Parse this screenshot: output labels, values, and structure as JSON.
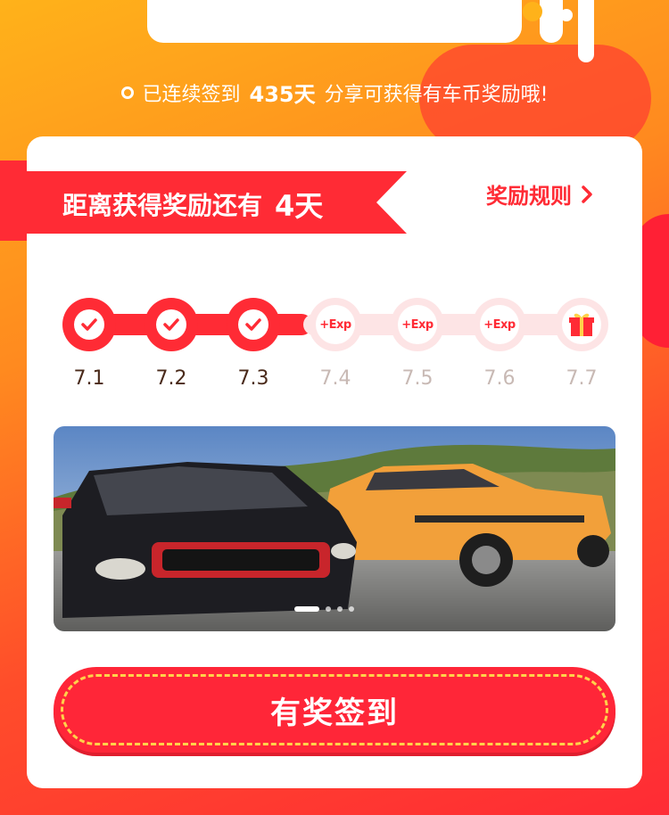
{
  "streak": {
    "prefix": "已连续签到",
    "days": "435天",
    "suffix": "分享可获得有车币奖励哦!"
  },
  "reward": {
    "label": "距离获得奖励还有",
    "days": "4天",
    "rules_label": "奖励规则"
  },
  "checkin": [
    {
      "date": "7.1",
      "status": "done",
      "badge": ""
    },
    {
      "date": "7.2",
      "status": "done",
      "badge": ""
    },
    {
      "date": "7.3",
      "status": "done",
      "badge": ""
    },
    {
      "date": "7.4",
      "status": "todo",
      "badge": "+Exp"
    },
    {
      "date": "7.5",
      "status": "todo",
      "badge": "+Exp"
    },
    {
      "date": "7.6",
      "status": "todo",
      "badge": "+Exp"
    },
    {
      "date": "7.7",
      "status": "gift",
      "badge": ""
    }
  ],
  "carousel": {
    "slides": 4,
    "active": 0
  },
  "button": {
    "label": "有奖签到"
  },
  "colors": {
    "primary": "#ff2b35",
    "accent": "#ffd24a",
    "track_inactive": "#fde4e5"
  }
}
